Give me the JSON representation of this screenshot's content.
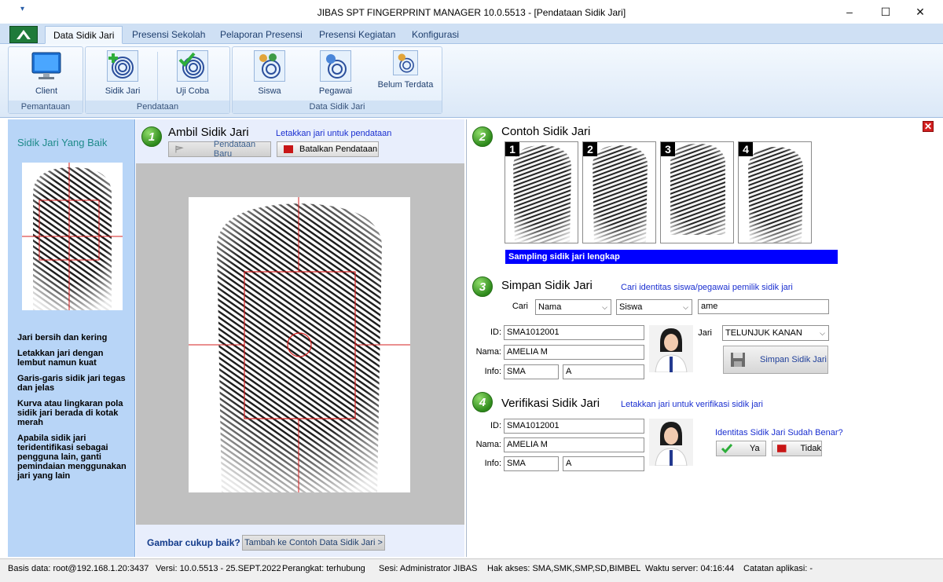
{
  "window": {
    "title": "JIBAS SPT FINGERPRINT MANAGER 10.0.5513 - [Pendataan Sidik Jari]",
    "quick_access": "▾",
    "minimize": "–",
    "maximize": "☐",
    "close": "✕"
  },
  "ribbon": {
    "tabs": [
      "Data Sidik Jari",
      "Presensi Sekolah",
      "Pelaporan Presensi",
      "Presensi Kegiatan",
      "Konfigurasi"
    ],
    "groups": {
      "pemantauan": {
        "label": "Pemantauan",
        "buttons": [
          "Client"
        ]
      },
      "pendataan": {
        "label": "Pendataan",
        "buttons": [
          "Sidik Jari",
          "Uji Coba"
        ]
      },
      "data_sidik_jari": {
        "label": "Data Sidik Jari",
        "buttons": [
          "Siswa",
          "Pegawai",
          "Belum Terdata"
        ]
      }
    }
  },
  "left": {
    "title": "Sidik Jari Yang Baik",
    "tips": [
      "Jari bersih dan kering",
      "Letakkan jari dengan lembut namun kuat",
      "Garis-garis sidik jari tegas dan jelas",
      "Kurva atau lingkaran pola sidik jari berada di kotak merah",
      "Apabila sidik jari teridentifikasi sebagai pengguna lain, ganti pemindaian menggunakan jari yang lain"
    ]
  },
  "step1": {
    "num": "1",
    "title": "Ambil Sidik Jari",
    "hint": "Letakkan jari untuk pendataan",
    "btn_new": "Pendataan Baru",
    "btn_cancel": "Batalkan Pendataan",
    "question": "Gambar cukup baik?",
    "btn_add": "Tambah ke Contoh Data Sidik Jari >"
  },
  "step2": {
    "num": "2",
    "title": "Contoh Sidik Jari",
    "samples": [
      "1",
      "2",
      "3",
      "4"
    ],
    "status": "Sampling sidik jari lengkap",
    "close": "✕"
  },
  "step3": {
    "num": "3",
    "title": "Simpan Sidik Jari",
    "hint": "Cari identitas siswa/pegawai pemilik sidik jari",
    "cari_label": "Cari",
    "cari_field": "Nama",
    "cari_type": "Siswa",
    "cari_query": "ame",
    "id_label": "ID:",
    "id": "SMA1012001",
    "nama_label": "Nama:",
    "nama": "AMELIA M",
    "info_label": "Info:",
    "info1": "SMA",
    "info2": "A",
    "jari_label": "Jari",
    "jari": "TELUNJUK KANAN",
    "btn_save": "Simpan Sidik Jari"
  },
  "step4": {
    "num": "4",
    "title": "Verifikasi Sidik Jari",
    "hint": "Letakkan jari untuk verifikasi sidik jari",
    "id_label": "ID:",
    "id": "SMA1012001",
    "nama_label": "Nama:",
    "nama": "AMELIA M",
    "info_label": "Info:",
    "info1": "SMA",
    "info2": "A",
    "question": "Identitas Sidik Jari Sudah Benar?",
    "btn_yes": "Ya",
    "btn_no": "Tidak"
  },
  "status": {
    "db": "Basis data: root@192.168.1.20:3437",
    "version": "Versi: 10.0.5513 - 25.SEPT.2022",
    "device": "Perangkat: terhubung",
    "session": "Sesi: Administrator JIBAS",
    "access": "Hak akses: SMA,SMK,SMP,SD,BIMBEL",
    "server_time": "Waktu server: 04:16:44",
    "notes": "Catatan aplikasi: -"
  },
  "colors": {
    "accent_blue": "#0000ff",
    "hint_blue": "#1a2fd0",
    "left_panel": "#b8d5f7",
    "step_green": "#2e8a1c",
    "red": "#d21f1f"
  }
}
